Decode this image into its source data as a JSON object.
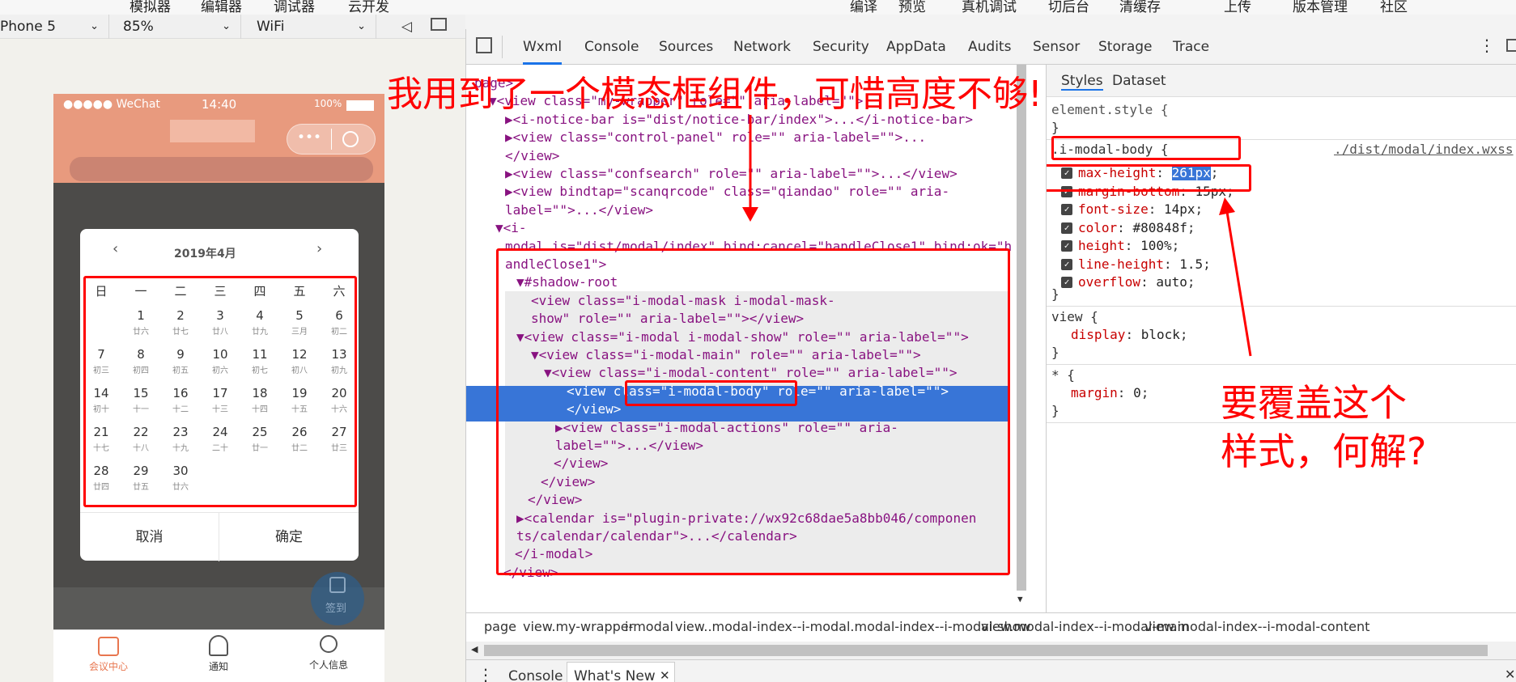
{
  "topbar": {
    "simulator": "模拟器",
    "editor": "编辑器",
    "debugger": "调试器",
    "cloud": "云开发",
    "compile": "编译",
    "preview": "预览",
    "real_debug": "真机调试",
    "background": "切后台",
    "clear_cache": "清缓存",
    "upload": "上传",
    "version": "版本管理",
    "community": "社区"
  },
  "simbar": {
    "device": "Phone 5",
    "zoom": "85%",
    "network": "WiFi"
  },
  "phone": {
    "carrier": "●●●●● WeChat",
    "time": "14:40",
    "battery": "100%",
    "calendar": {
      "month": "2019年4月",
      "weekdays": [
        "日",
        "一",
        "二",
        "三",
        "四",
        "五",
        "六"
      ],
      "days": [
        {
          "d": "1",
          "l": "廿六"
        },
        {
          "d": "2",
          "l": "廿七"
        },
        {
          "d": "3",
          "l": "廿八"
        },
        {
          "d": "4",
          "l": "廿九"
        },
        {
          "d": "5",
          "l": "三月"
        },
        {
          "d": "6",
          "l": "初二"
        },
        {
          "d": "7",
          "l": "初三"
        },
        {
          "d": "8",
          "l": "初四"
        },
        {
          "d": "9",
          "l": "初五"
        },
        {
          "d": "10",
          "l": "初六"
        },
        {
          "d": "11",
          "l": "初七"
        },
        {
          "d": "12",
          "l": "初八"
        },
        {
          "d": "13",
          "l": "初九"
        },
        {
          "d": "14",
          "l": "初十"
        },
        {
          "d": "15",
          "l": "十一"
        },
        {
          "d": "16",
          "l": "十二"
        },
        {
          "d": "17",
          "l": "十三"
        },
        {
          "d": "18",
          "l": "十四"
        },
        {
          "d": "19",
          "l": "十五"
        },
        {
          "d": "20",
          "l": "十六"
        },
        {
          "d": "21",
          "l": "十七"
        },
        {
          "d": "22",
          "l": "十八"
        },
        {
          "d": "23",
          "l": "十九"
        },
        {
          "d": "24",
          "l": "二十"
        },
        {
          "d": "25",
          "l": "廿一"
        },
        {
          "d": "26",
          "l": "廿二"
        },
        {
          "d": "27",
          "l": "廿三"
        },
        {
          "d": "28",
          "l": "廿四"
        },
        {
          "d": "29",
          "l": "廿五"
        },
        {
          "d": "30",
          "l": "廿六"
        }
      ],
      "cancel": "取消",
      "confirm": "确定"
    },
    "signin": "签到",
    "tabs": [
      "会议中心",
      "通知",
      "个人信息"
    ]
  },
  "devtools": {
    "tabs": [
      "Wxml",
      "Console",
      "Sources",
      "Network",
      "Security",
      "AppData",
      "Audits",
      "Sensor",
      "Storage",
      "Trace"
    ],
    "style_tabs": [
      "Styles",
      "Dataset"
    ],
    "tree": [
      {
        "t": "page>"
      },
      {
        "t": "▼<view class=\"my-wrapper\" role=\"\" aria-label=\"\">"
      },
      {
        "t": "▶<i-notice-bar is=\"dist/notice-bar/index\">...</i-notice-bar>"
      },
      {
        "t": "▶<view class=\"control-panel\" role=\"\" aria-label=\"\">..."
      },
      {
        "t": "</view>"
      },
      {
        "t": "▶<view class=\"confsearch\" role=\"\" aria-label=\"\">...</view>"
      },
      {
        "t": "▶<view bindtap=\"scanqrcode\" class=\"qiandao\" role=\"\" aria-"
      },
      {
        "t": "label=\"\">...</view>"
      },
      {
        "t": "▼<i-"
      },
      {
        "t": "modal is=\"dist/modal/index\" bind:cancel=\"handleClose1\" bind:ok=\"h"
      },
      {
        "t": "andleClose1\">"
      },
      {
        "t": "▼#shadow-root"
      },
      {
        "t": "<view class=\"i-modal-mask i-modal-mask-"
      },
      {
        "t": "show\" role=\"\" aria-label=\"\"></view>"
      },
      {
        "t": "▼<view class=\"i-modal i-modal-show\" role=\"\" aria-label=\"\">"
      },
      {
        "t": "▼<view class=\"i-modal-main\" role=\"\" aria-label=\"\">"
      },
      {
        "t": "▼<view class=\"i-modal-content\" role=\"\" aria-label=\"\">"
      },
      {
        "t": "<view class=\"i-modal-body\" role=\"\" aria-label=\"\">"
      },
      {
        "t": "</view>"
      },
      {
        "t": "▶<view class=\"i-modal-actions\" role=\"\" aria-"
      },
      {
        "t": "label=\"\">...</view>"
      },
      {
        "t": "</view>"
      },
      {
        "t": "</view>"
      },
      {
        "t": "</view>"
      },
      {
        "t": "▶<calendar is=\"plugin-private://wx92c68dae5a8bb046/componen"
      },
      {
        "t": "ts/calendar/calendar\">...</calendar>"
      },
      {
        "t": "</i-modal>"
      },
      {
        "t": "</view>"
      }
    ],
    "styles": {
      "element_style": "element.style {",
      "close": "}",
      "rule_selector": ".i-modal-body {",
      "rule_source": "./dist/modal/index.wxss",
      "props": [
        {
          "n": "max-height",
          "v": "261px"
        },
        {
          "n": "margin-bottom",
          "v": "15px"
        },
        {
          "n": "font-size",
          "v": "14px"
        },
        {
          "n": "color",
          "v": "#80848f"
        },
        {
          "n": "height",
          "v": "100%"
        },
        {
          "n": "line-height",
          "v": "1.5"
        },
        {
          "n": "overflow",
          "v": "auto"
        }
      ],
      "view_rule": "view {",
      "view_prop": {
        "n": "display",
        "v": "block"
      },
      "star_rule": "* {",
      "star_prop": {
        "n": "margin",
        "v": "0"
      }
    },
    "breadcrumbs": [
      "page",
      "view.my-wrapper",
      "i-modal",
      "view..modal-index--i-modal.modal-index--i-modal-show",
      "view.modal-index--i-modal-main",
      "view.modal-index--i-modal-content"
    ],
    "drawer_tabs": [
      "Console",
      "What's New"
    ]
  },
  "annotations": {
    "top": "我用到了一个模态框组件，可惜高度不够!",
    "right_line1": "要覆盖这个",
    "right_line2": "样式，何解?"
  },
  "colors": {
    "accent_red": "#ff0000",
    "nav_orange": "#e89a7e",
    "select_blue": "#3875d7"
  }
}
